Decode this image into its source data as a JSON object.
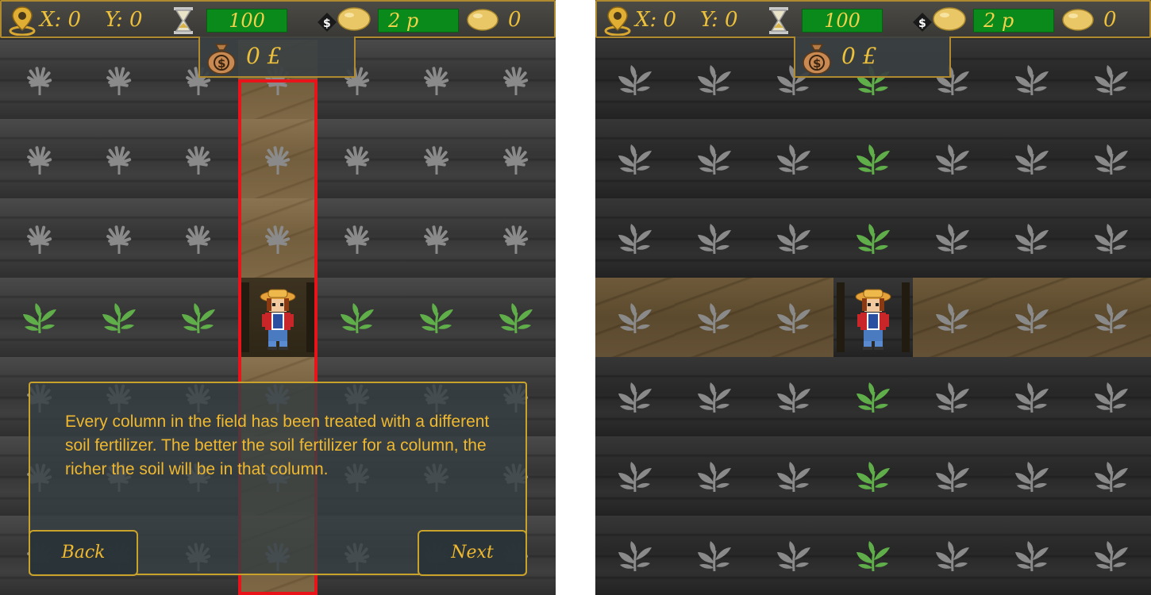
{
  "hud": {
    "x_label": "X: 0",
    "y_label": "Y: 0",
    "timer_value": "100",
    "price_value": "2 p",
    "potato_count": "0",
    "money": "0 £"
  },
  "tutorial": {
    "message": "Every column in the field has been treated with a different soil fertilizer. The better the soil fertilizer for a column, the richer the soil will be in that column.",
    "back_label": "Back",
    "next_label": "Next"
  },
  "colors": {
    "hud_text": "#ecc03a",
    "hud_box": "#0a8a1a",
    "highlight": "#e8141a",
    "dialog_border": "#c9a22c",
    "plant_green": "#5fae4a",
    "plant_gray": "#8a8a8a"
  },
  "icons": {
    "location": "map-pin-icon",
    "timer": "hourglass-icon",
    "price": "price-tag-potato-icon",
    "harvest": "potato-icon",
    "money": "money-bag-icon"
  }
}
